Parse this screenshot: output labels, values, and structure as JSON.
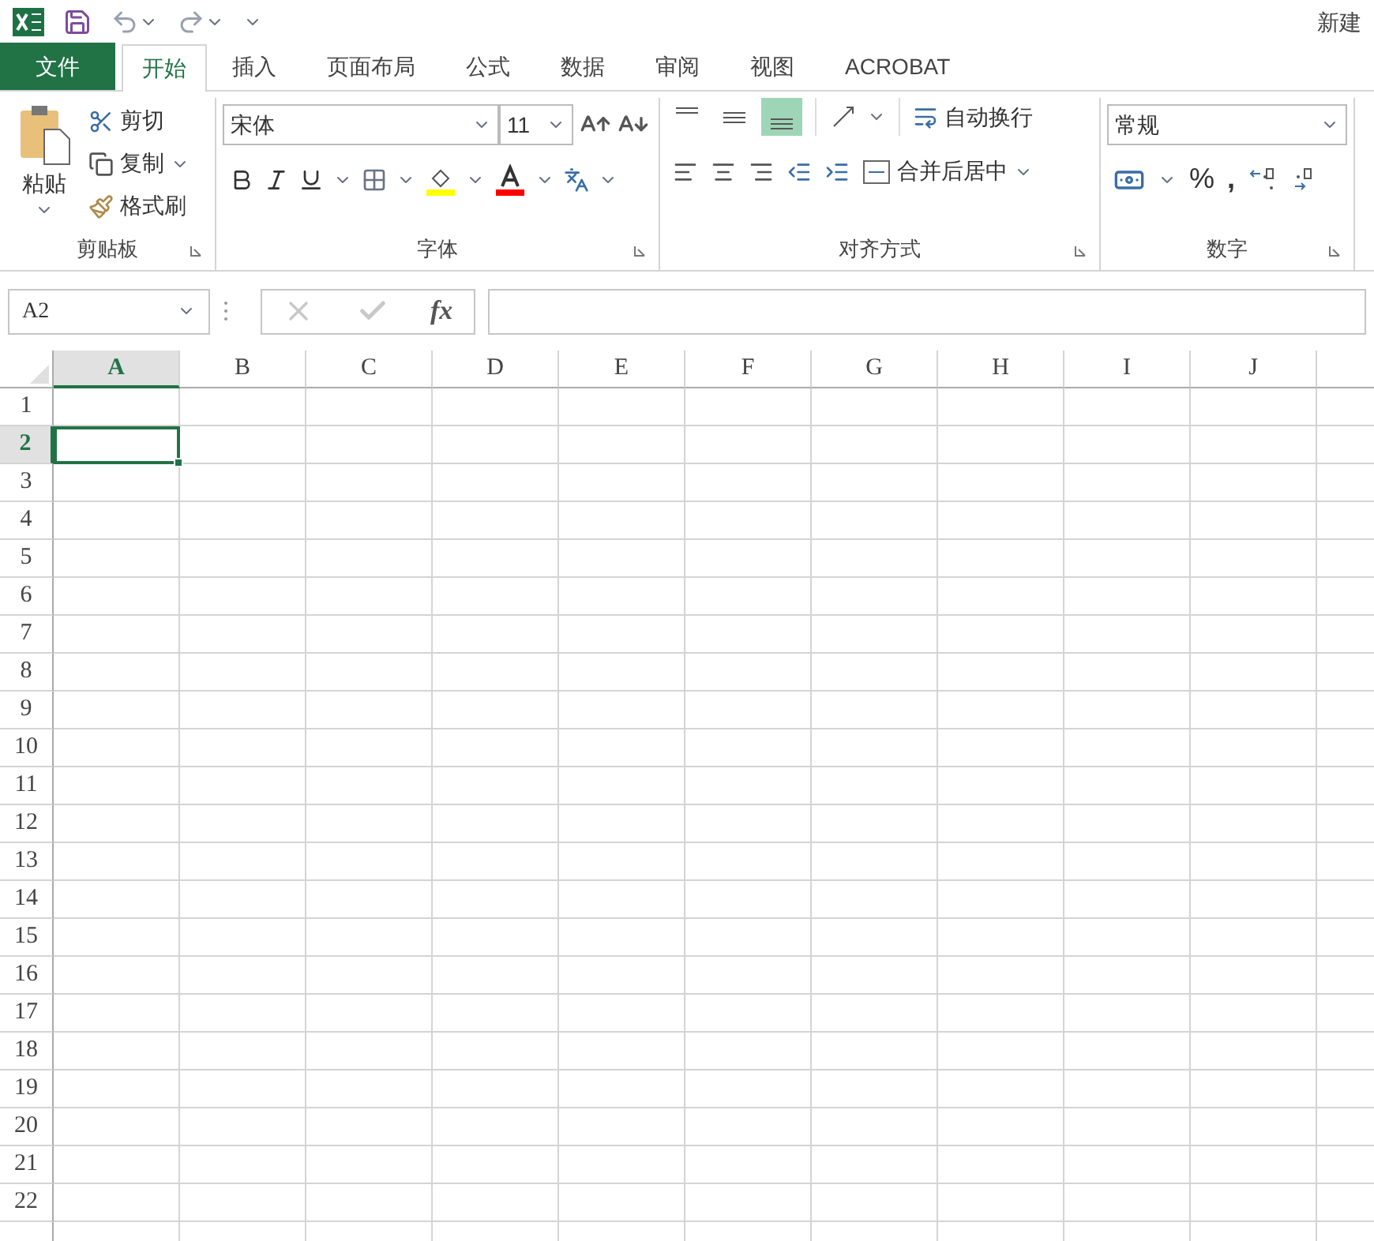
{
  "title_bar": {
    "document": "新建"
  },
  "tabs": [
    {
      "label": "文件",
      "kind": "file",
      "selected": false
    },
    {
      "label": "开始",
      "kind": "tab",
      "selected": true
    },
    {
      "label": "插入",
      "kind": "tab",
      "selected": false
    },
    {
      "label": "页面布局",
      "kind": "tab",
      "selected": false
    },
    {
      "label": "公式",
      "kind": "tab",
      "selected": false
    },
    {
      "label": "数据",
      "kind": "tab",
      "selected": false
    },
    {
      "label": "审阅",
      "kind": "tab",
      "selected": false
    },
    {
      "label": "视图",
      "kind": "tab",
      "selected": false
    },
    {
      "label": "ACROBAT",
      "kind": "tab",
      "selected": false
    }
  ],
  "ribbon": {
    "clipboard": {
      "paste": "粘贴",
      "cut": "剪切",
      "copy": "复制",
      "format_painter": "格式刷",
      "label": "剪贴板"
    },
    "font": {
      "name": "宋体",
      "size": "11",
      "label": "字体"
    },
    "alignment": {
      "vertical": [
        {
          "selected": false
        },
        {
          "selected": false
        },
        {
          "selected": true
        }
      ],
      "wrap": "自动换行",
      "merge": "合并后居中",
      "label": "对齐方式"
    },
    "number": {
      "format": "常规",
      "percent": "%",
      "comma": ",",
      "label": "数字"
    }
  },
  "formula_bar": {
    "name_box": "A2",
    "function": "fx"
  },
  "sheet": {
    "columns": [
      {
        "label": "A",
        "selected": true
      },
      {
        "label": "B",
        "selected": false
      },
      {
        "label": "C",
        "selected": false
      },
      {
        "label": "D",
        "selected": false
      },
      {
        "label": "E",
        "selected": false
      },
      {
        "label": "F",
        "selected": false
      },
      {
        "label": "G",
        "selected": false
      },
      {
        "label": "H",
        "selected": false
      },
      {
        "label": "I",
        "selected": false
      },
      {
        "label": "J",
        "selected": false
      }
    ],
    "rows": [
      {
        "label": "1",
        "selected": false
      },
      {
        "label": "2",
        "selected": true
      },
      {
        "label": "3",
        "selected": false
      },
      {
        "label": "4",
        "selected": false
      },
      {
        "label": "5",
        "selected": false
      },
      {
        "label": "6",
        "selected": false
      },
      {
        "label": "7",
        "selected": false
      },
      {
        "label": "8",
        "selected": false
      },
      {
        "label": "9",
        "selected": false
      },
      {
        "label": "10",
        "selected": false
      },
      {
        "label": "11",
        "selected": false
      },
      {
        "label": "12",
        "selected": false
      },
      {
        "label": "13",
        "selected": false
      },
      {
        "label": "14",
        "selected": false
      },
      {
        "label": "15",
        "selected": false
      },
      {
        "label": "16",
        "selected": false
      },
      {
        "label": "17",
        "selected": false
      },
      {
        "label": "18",
        "selected": false
      },
      {
        "label": "19",
        "selected": false
      },
      {
        "label": "20",
        "selected": false
      },
      {
        "label": "21",
        "selected": false
      },
      {
        "label": "22",
        "selected": false
      }
    ]
  }
}
